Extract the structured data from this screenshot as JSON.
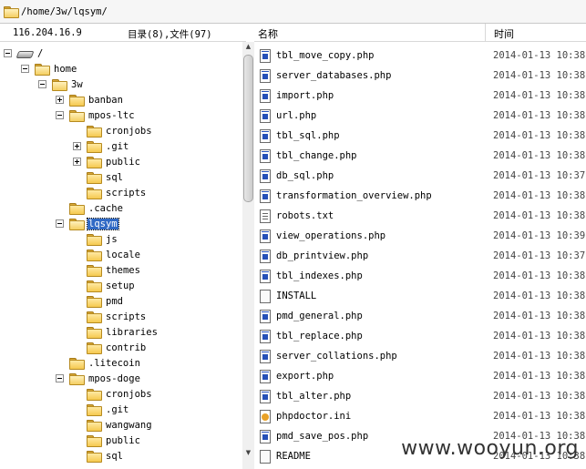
{
  "path_bar": {
    "path": "/home/3w/lqsym/"
  },
  "left_header": {
    "host": "116.204.16.9",
    "summary": "目录(8),文件(97)"
  },
  "tree": [
    {
      "label": "/",
      "level": 0,
      "expander": "minus",
      "icon": "drive-icon"
    },
    {
      "label": "home",
      "level": 1,
      "expander": "minus",
      "icon": "folder-icon"
    },
    {
      "label": "3w",
      "level": 2,
      "expander": "minus",
      "icon": "folder-icon"
    },
    {
      "label": "banban",
      "level": 3,
      "expander": "plus",
      "icon": "folder-icon"
    },
    {
      "label": "mpos-ltc",
      "level": 3,
      "expander": "minus",
      "icon": "folder-icon"
    },
    {
      "label": "cronjobs",
      "level": 4,
      "expander": "",
      "icon": "folder-icon"
    },
    {
      "label": ".git",
      "level": 4,
      "expander": "plus",
      "icon": "folder-icon"
    },
    {
      "label": "public",
      "level": 4,
      "expander": "plus",
      "icon": "folder-icon"
    },
    {
      "label": "sql",
      "level": 4,
      "expander": "",
      "icon": "folder-icon"
    },
    {
      "label": "scripts",
      "level": 4,
      "expander": "",
      "icon": "folder-icon"
    },
    {
      "label": ".cache",
      "level": 3,
      "expander": "",
      "icon": "folder-icon"
    },
    {
      "label": "lqsym",
      "level": 3,
      "expander": "minus",
      "icon": "folder-icon",
      "selected": true
    },
    {
      "label": "js",
      "level": 4,
      "expander": "",
      "icon": "folder-icon"
    },
    {
      "label": "locale",
      "level": 4,
      "expander": "",
      "icon": "folder-icon"
    },
    {
      "label": "themes",
      "level": 4,
      "expander": "",
      "icon": "folder-icon"
    },
    {
      "label": "setup",
      "level": 4,
      "expander": "",
      "icon": "folder-icon"
    },
    {
      "label": "pmd",
      "level": 4,
      "expander": "",
      "icon": "folder-icon"
    },
    {
      "label": "scripts",
      "level": 4,
      "expander": "",
      "icon": "folder-icon"
    },
    {
      "label": "libraries",
      "level": 4,
      "expander": "",
      "icon": "folder-icon"
    },
    {
      "label": "contrib",
      "level": 4,
      "expander": "",
      "icon": "folder-icon"
    },
    {
      "label": ".litecoin",
      "level": 3,
      "expander": "",
      "icon": "folder-icon"
    },
    {
      "label": "mpos-doge",
      "level": 3,
      "expander": "minus",
      "icon": "folder-icon"
    },
    {
      "label": "cronjobs",
      "level": 4,
      "expander": "",
      "icon": "folder-icon"
    },
    {
      "label": ".git",
      "level": 4,
      "expander": "",
      "icon": "folder-icon"
    },
    {
      "label": "wangwang",
      "level": 4,
      "expander": "",
      "icon": "folder-icon"
    },
    {
      "label": "public",
      "level": 4,
      "expander": "",
      "icon": "folder-icon"
    },
    {
      "label": "sql",
      "level": 4,
      "expander": "",
      "icon": "folder-icon"
    }
  ],
  "file_list": {
    "columns": {
      "name": "名称",
      "time": "时间"
    },
    "files": [
      {
        "name": "tbl_move_copy.php",
        "time": "2014-01-13 10:38:",
        "icon": "php-file-icon",
        "type": "php"
      },
      {
        "name": "server_databases.php",
        "time": "2014-01-13 10:38:",
        "icon": "php-file-icon",
        "type": "php"
      },
      {
        "name": "import.php",
        "time": "2014-01-13 10:38:",
        "icon": "php-file-icon",
        "type": "php"
      },
      {
        "name": "url.php",
        "time": "2014-01-13 10:38:",
        "icon": "php-file-icon",
        "type": "php"
      },
      {
        "name": "tbl_sql.php",
        "time": "2014-01-13 10:38:",
        "icon": "php-file-icon",
        "type": "php"
      },
      {
        "name": "tbl_change.php",
        "time": "2014-01-13 10:38:",
        "icon": "php-file-icon",
        "type": "php"
      },
      {
        "name": "db_sql.php",
        "time": "2014-01-13 10:37:",
        "icon": "php-file-icon",
        "type": "php"
      },
      {
        "name": "transformation_overview.php",
        "time": "2014-01-13 10:38:",
        "icon": "php-file-icon",
        "type": "php"
      },
      {
        "name": "robots.txt",
        "time": "2014-01-13 10:38:",
        "icon": "text-file-icon",
        "type": "txt"
      },
      {
        "name": "view_operations.php",
        "time": "2014-01-13 10:39:",
        "icon": "php-file-icon",
        "type": "php"
      },
      {
        "name": "db_printview.php",
        "time": "2014-01-13 10:37:",
        "icon": "php-file-icon",
        "type": "php"
      },
      {
        "name": "tbl_indexes.php",
        "time": "2014-01-13 10:38:",
        "icon": "php-file-icon",
        "type": "php"
      },
      {
        "name": "INSTALL",
        "time": "2014-01-13 10:38:",
        "icon": "generic-file-icon",
        "type": "gen"
      },
      {
        "name": "pmd_general.php",
        "time": "2014-01-13 10:38:",
        "icon": "php-file-icon",
        "type": "php"
      },
      {
        "name": "tbl_replace.php",
        "time": "2014-01-13 10:38:",
        "icon": "php-file-icon",
        "type": "php"
      },
      {
        "name": "server_collations.php",
        "time": "2014-01-13 10:38:",
        "icon": "php-file-icon",
        "type": "php"
      },
      {
        "name": "export.php",
        "time": "2014-01-13 10:38:",
        "icon": "php-file-icon",
        "type": "php"
      },
      {
        "name": "tbl_alter.php",
        "time": "2014-01-13 10:38:",
        "icon": "php-file-icon",
        "type": "php"
      },
      {
        "name": "phpdoctor.ini",
        "time": "2014-01-13 10:38:",
        "icon": "ini-file-icon",
        "type": "ini"
      },
      {
        "name": "pmd_save_pos.php",
        "time": "2014-01-13 10:38:",
        "icon": "php-file-icon",
        "type": "php"
      },
      {
        "name": "README",
        "time": "2014-01-13 10:38:",
        "icon": "generic-file-icon",
        "type": "gen"
      }
    ]
  },
  "watermark": "www.wooyun.org"
}
